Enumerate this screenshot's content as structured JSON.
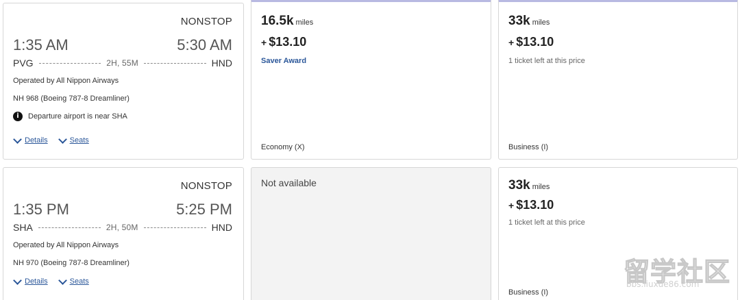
{
  "flights": [
    {
      "stops": "NONSTOP",
      "depart_time": "1:35 AM",
      "arrive_time": "5:30 AM",
      "origin": "PVG",
      "destination": "HND",
      "duration": "2H, 55M",
      "operator": "Operated by All Nippon Airways",
      "flight_number": "NH 968 (Boeing 787-8 Dreamliner)",
      "notice": "Departure airport is near SHA",
      "details_label": "Details",
      "seats_label": "Seats",
      "fares": [
        {
          "miles": "16.5k",
          "miles_unit": "miles",
          "plus": "+",
          "price": "$13.10",
          "note": "Saver Award",
          "cabin": "Economy (X)"
        },
        {
          "miles": "33k",
          "miles_unit": "miles",
          "plus": "+",
          "price": "$13.10",
          "note": "1 ticket left at this price",
          "cabin": "Business (I)"
        }
      ]
    },
    {
      "stops": "NONSTOP",
      "depart_time": "1:35 PM",
      "arrive_time": "5:25 PM",
      "origin": "SHA",
      "destination": "HND",
      "duration": "2H, 50M",
      "operator": "Operated by All Nippon Airways",
      "flight_number": "NH 970 (Boeing 787-8 Dreamliner)",
      "details_label": "Details",
      "seats_label": "Seats",
      "fares": [
        {
          "not_available": "Not available"
        },
        {
          "miles": "33k",
          "miles_unit": "miles",
          "plus": "+",
          "price": "$13.10",
          "note": "1 ticket left at this price",
          "cabin": "Business (I)"
        }
      ]
    }
  ],
  "icons": {
    "info": "info-circle-icon",
    "chevron": "chevron-down-icon"
  },
  "colors": {
    "link": "#2a5699",
    "selected_column_bar": "#b8b9e2",
    "unavailable_bg": "#f3f3f3"
  },
  "watermark": {
    "title": "留学社区",
    "url": "bbs.liuxue86.com"
  }
}
